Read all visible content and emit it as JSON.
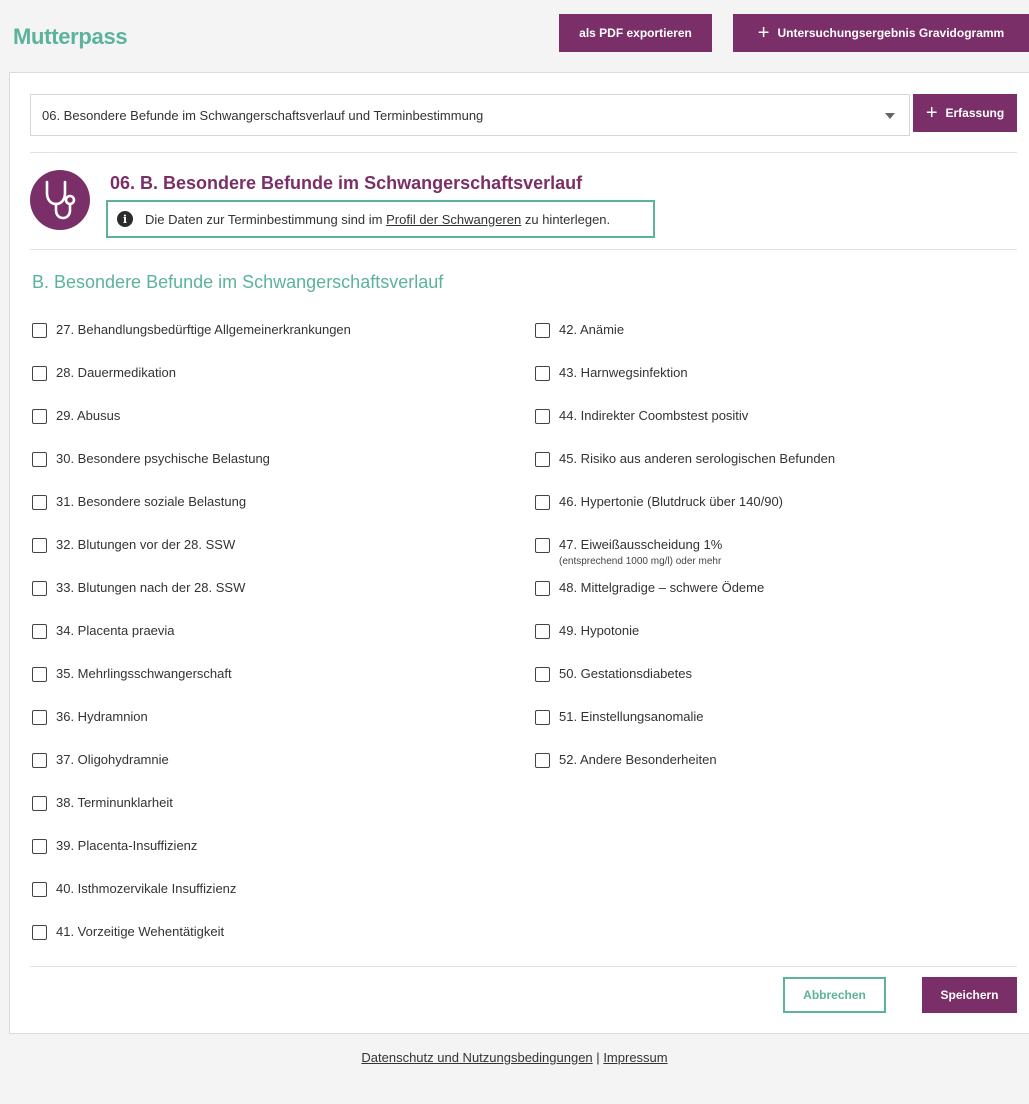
{
  "header": {
    "title": "Mutterpass",
    "export_label": "als PDF exportieren",
    "exam_label": "Untersuchungsergebnis Gravidogramm"
  },
  "section_select": {
    "value": "06. Besondere Befunde im Schwangerschaftsverlauf und Terminbestimmung",
    "add_label": "Erfassung"
  },
  "section": {
    "title": "06. B. Besondere Befunde im Schwangerschaftsverlauf",
    "info_prefix": "Die Daten zur Terminbestimmung sind im",
    "info_link": "Profil der Schwangeren",
    "info_suffix": "zu hinterlegen.",
    "subheading": "B. Besondere Befunde im Schwangerschaftsverlauf"
  },
  "left_items": [
    {
      "label": "27. Behandlungsbedürftige Allgemeinerkrankungen",
      "checked": false
    },
    {
      "label": "28. Dauermedikation",
      "checked": false
    },
    {
      "label": "29. Abusus",
      "checked": false
    },
    {
      "label": "30. Besondere psychische Belastung",
      "checked": false
    },
    {
      "label": "31. Besondere soziale Belastung",
      "checked": false
    },
    {
      "label": "32. Blutungen vor der 28. SSW",
      "checked": false
    },
    {
      "label": "33. Blutungen nach der 28. SSW",
      "checked": false
    },
    {
      "label": "34. Placenta praevia",
      "checked": false
    },
    {
      "label": "35. Mehrlingsschwangerschaft",
      "checked": false
    },
    {
      "label": "36. Hydramnion",
      "checked": false
    },
    {
      "label": "37. Oligohydramnie",
      "checked": false
    },
    {
      "label": "38. Terminunklarheit",
      "checked": false
    },
    {
      "label": "39. Placenta-Insuffizienz",
      "checked": false
    },
    {
      "label": "40. Isthmozervikale Insuffizienz",
      "checked": false
    },
    {
      "label": "41. Vorzeitige Wehentätigkeit",
      "checked": false
    }
  ],
  "right_items": [
    {
      "label": "42. Anämie",
      "checked": false
    },
    {
      "label": "43. Harnwegsinfektion",
      "checked": false
    },
    {
      "label": "44. Indirekter Coombstest positiv",
      "checked": false
    },
    {
      "label": "45. Risiko aus anderen serologischen Befunden",
      "checked": false
    },
    {
      "label": "46. Hypertonie (Blutdruck über 140/90)",
      "checked": false
    },
    {
      "label": "47. Eiweißausscheidung 1%",
      "sublabel": "(entsprechend 1000 mg/l) oder mehr",
      "checked": false
    },
    {
      "label": "48. Mittelgradige – schwere Ödeme",
      "checked": false
    },
    {
      "label": "49. Hypotonie",
      "checked": false
    },
    {
      "label": "50. Gestationsdiabetes",
      "checked": false
    },
    {
      "label": "51. Einstellungsanomalie",
      "checked": false
    },
    {
      "label": "52. Andere Besonderheiten",
      "checked": false
    }
  ],
  "actions": {
    "cancel_label": "Abbrechen",
    "save_label": "Speichern"
  },
  "footer": {
    "privacy_label": "Datenschutz und Nutzungsbedingungen",
    "separator": "|",
    "imprint_label": "Impressum"
  },
  "colors": {
    "brand_purple": "#7b2f68",
    "brand_green": "#5bb39a"
  },
  "icons": {
    "section": "stethoscope-icon",
    "info": "info-icon",
    "dropdown": "caret-down-icon",
    "add": "plus-icon"
  }
}
